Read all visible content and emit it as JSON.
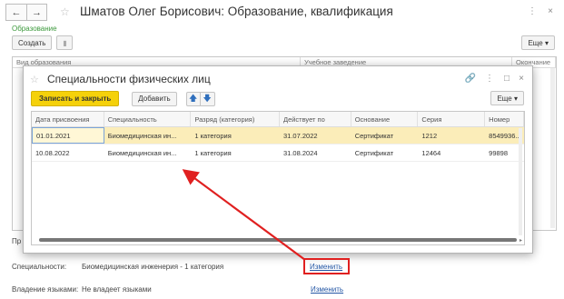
{
  "window": {
    "title": "Шматов Олег Борисович: Образование, квалификация",
    "back_icon": "←",
    "forward_icon": "→",
    "subtab": "Образование",
    "create_label": "Создать",
    "more_label": "Еще",
    "more_arrow": "▾",
    "columns": [
      "Вид образования",
      "Учебное заведение",
      "Окончание"
    ],
    "info": {
      "partial_label": "Пр",
      "specialties_label": "Специальности:",
      "specialties_value": "Биомедицинская инженерия - 1 категория",
      "specialties_link": "Изменить",
      "languages_label": "Владение языками:",
      "languages_value": "Не владеет языками",
      "languages_link": "Изменить"
    }
  },
  "dialog": {
    "title": "Специальности физических лиц",
    "save_close_label": "Записать и закрыть",
    "add_label": "Добавить",
    "up_icon": "🡅",
    "down_icon": "🡇",
    "more_label": "Еще",
    "more_arrow": "▾",
    "columns": [
      "Дата присвоения",
      "Специальность",
      "Разряд (категория)",
      "Действует по",
      "Основание",
      "Серия",
      "Номер"
    ],
    "rows": [
      [
        "01.01.2021",
        "Биомедицинская ин...",
        "1 категория",
        "31.07.2022",
        "Сертификат",
        "1212",
        "8549936..."
      ],
      [
        "10.08.2022",
        "Биомедицинская ин...",
        "1 категория",
        "31.08.2024",
        "Сертификат",
        "12464",
        "99898"
      ]
    ]
  },
  "colors": {
    "accent_yellow": "#f5d10a",
    "selected_row": "#fbedb9",
    "link_blue": "#2457a5",
    "annotation_red": "#e02020",
    "tab_green": "#3d9a3d"
  }
}
